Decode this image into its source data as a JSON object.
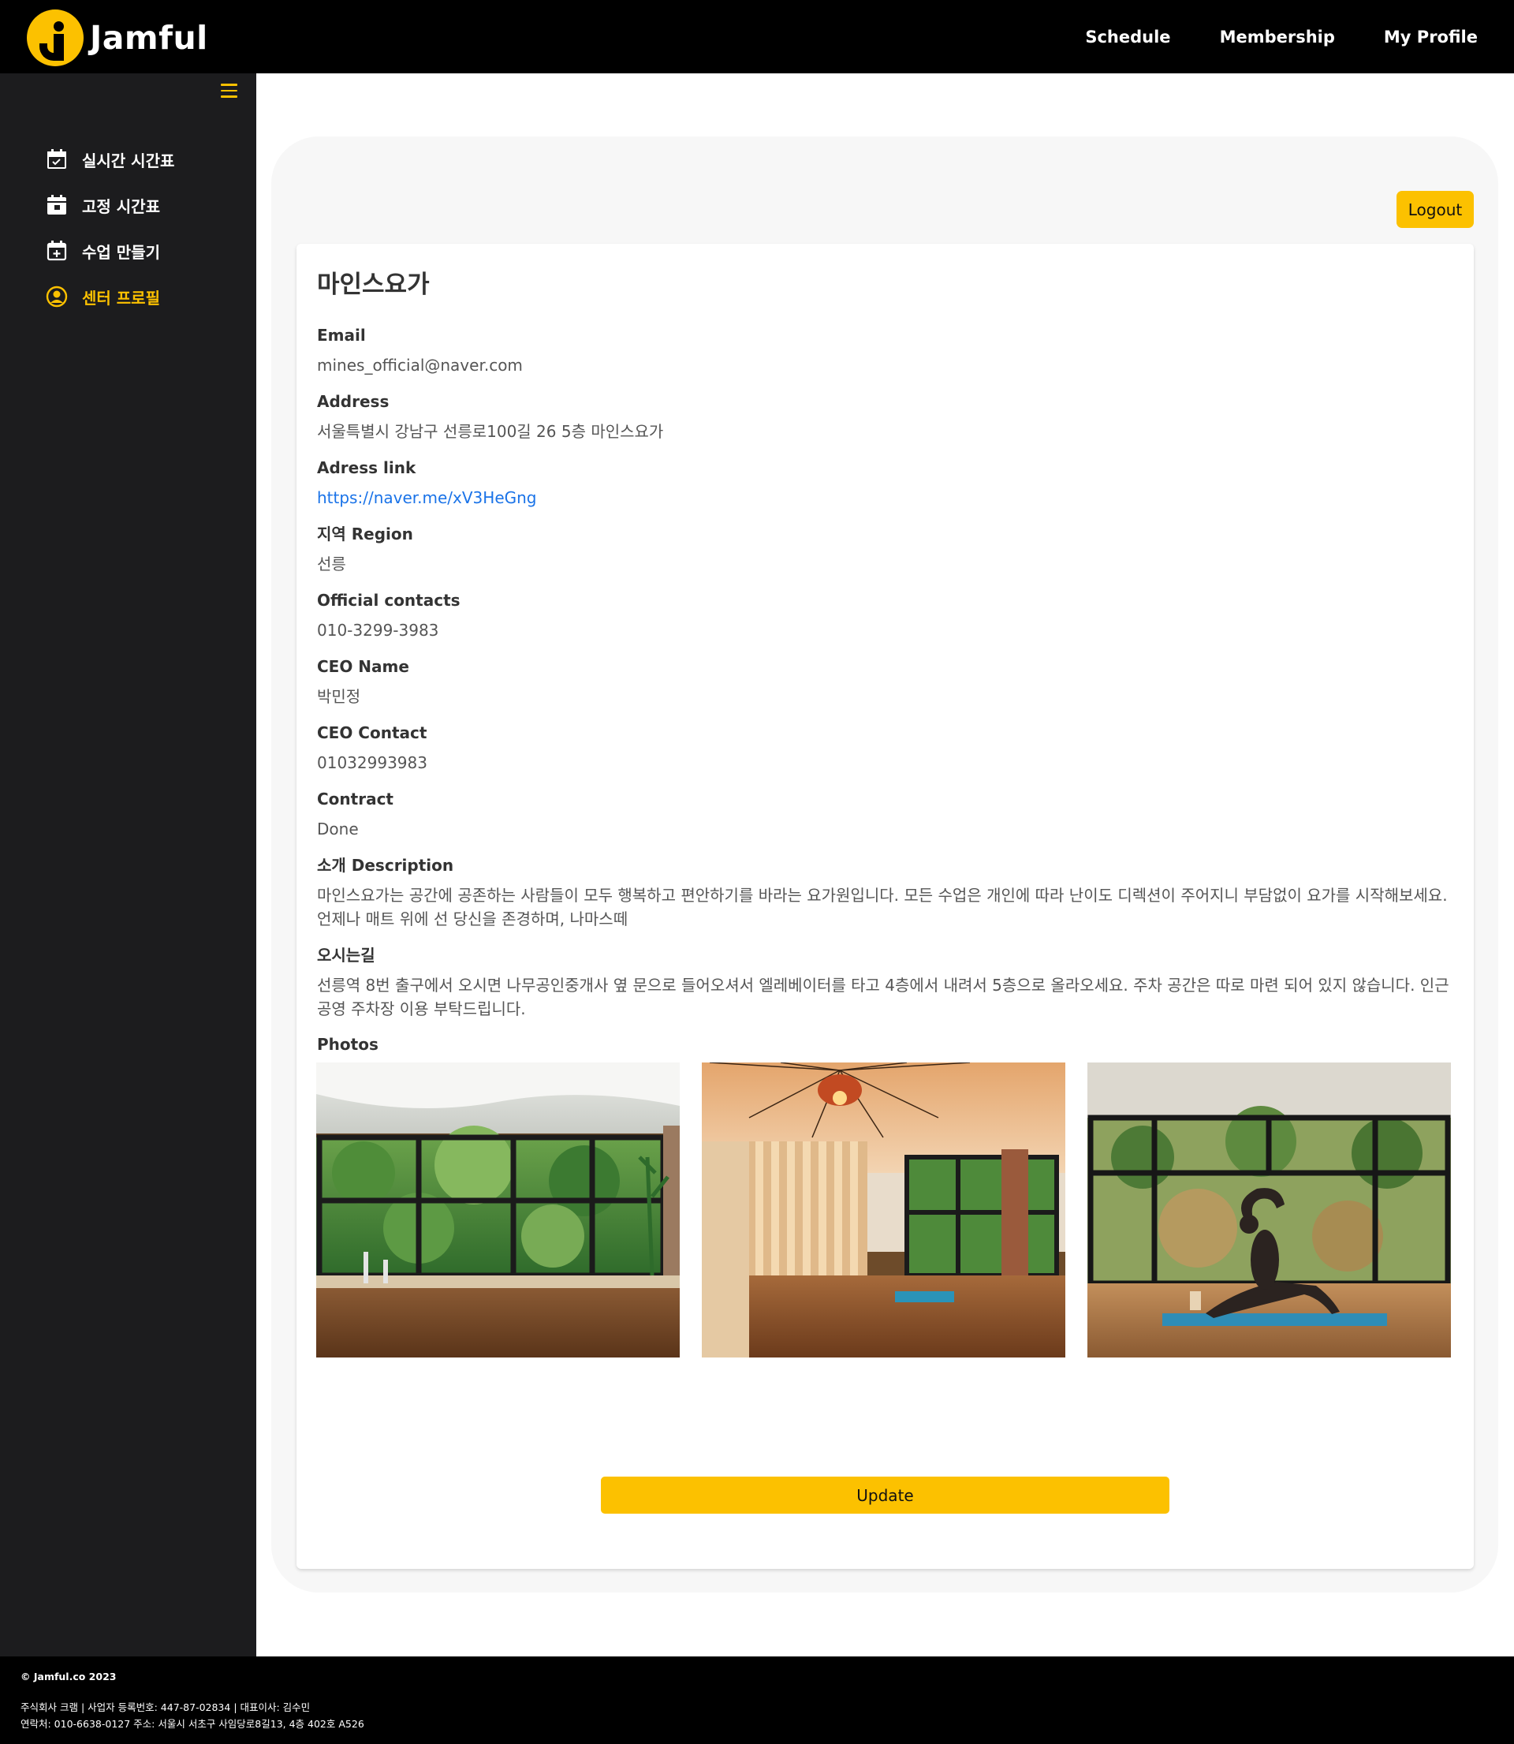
{
  "brand": {
    "name": "Jamful",
    "accent": "#fcc100"
  },
  "topnav": [
    "Schedule",
    "Membership",
    "My Profile"
  ],
  "sidebar": {
    "items": [
      {
        "label": "실시간 시간표",
        "icon": "calendar-check-icon",
        "active": false
      },
      {
        "label": "고정 시간표",
        "icon": "calendar-event-icon",
        "active": false
      },
      {
        "label": "수업 만들기",
        "icon": "calendar-plus-icon",
        "active": false
      },
      {
        "label": "센터 프로필",
        "icon": "user-circle-icon",
        "active": true
      }
    ]
  },
  "actions": {
    "logout": "Logout",
    "update": "Update"
  },
  "profile": {
    "name": "마인스요가",
    "fields": [
      {
        "label": "Email",
        "value": "mines_official@naver.com"
      },
      {
        "label": "Address",
        "value": "서울특별시 강남구 선릉로100길 26 5층 마인스요가"
      },
      {
        "label": "Adress link",
        "value": "https://naver.me/xV3HeGng",
        "is_link": true
      },
      {
        "label": "지역 Region",
        "value": "선릉"
      },
      {
        "label": "Official contacts",
        "value": "010-3299-3983"
      },
      {
        "label": "CEO Name",
        "value": "박민정"
      },
      {
        "label": "CEO Contact",
        "value": "01032993983"
      },
      {
        "label": "Contract",
        "value": "Done"
      },
      {
        "label": "소개 Description",
        "value": "마인스요가는 공간에 공존하는 사람들이 모두 행복하고 편안하기를 바라는 요가원입니다. 모든 수업은 개인에 따라 난이도 디렉션이 주어지니 부담없이 요가를 시작해보세요. 언제나 매트 위에 선 당신을 존경하며, 나마스떼"
      },
      {
        "label": "오시는길",
        "value": "선릉역 8번 출구에서 오시면 나무공인중개사 옆 문으로 들어오셔서 엘레베이터를 타고 4층에서 내려서 5층으로 올라오세요. 주차 공간은 따로 마련 되어 있지 않습니다. 인근 공영 주차장 이용 부탁드립니다."
      }
    ],
    "photos_label": "Photos",
    "photos": [
      "studio-window-photo",
      "studio-interior-photo",
      "yoga-pose-photo"
    ]
  },
  "footer": {
    "copyright": "© Jamful.co 2023",
    "company": "주식회사 크램 | 사업자 등록번호: 447-87-02834 | 대표이사: 김수민",
    "contact": "연락처: 010-6638-0127 주소: 서울시 서초구 사임당로8길13, 4층 402호 A526"
  }
}
